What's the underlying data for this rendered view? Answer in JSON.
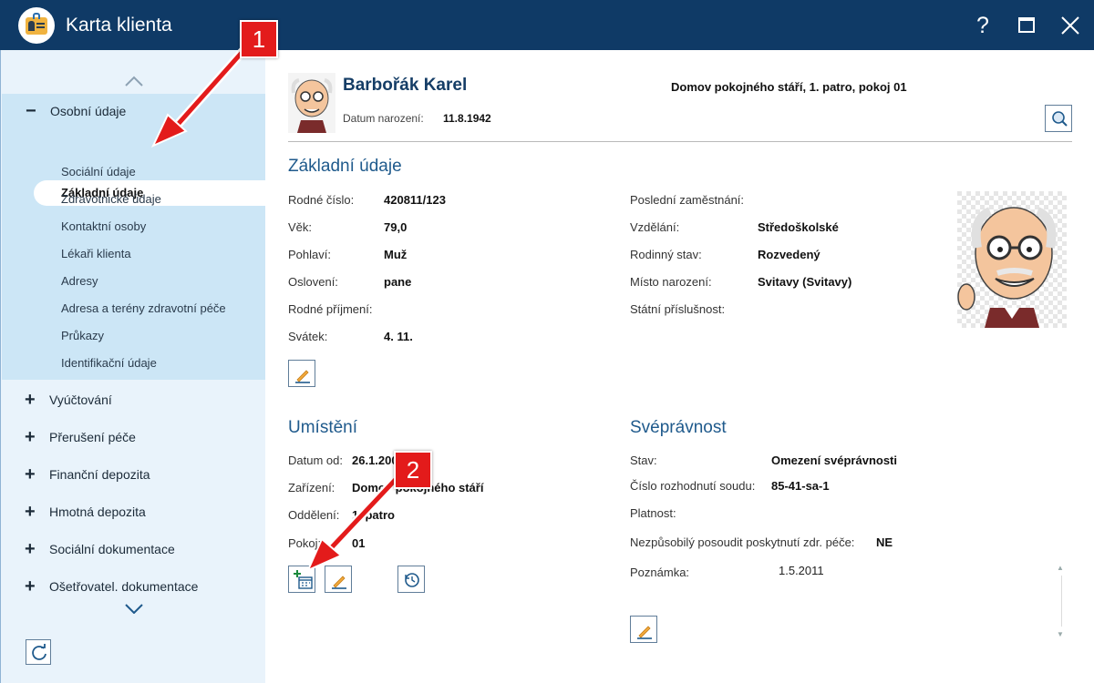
{
  "window": {
    "title": "Karta klienta",
    "help_label": "?"
  },
  "sidebar": {
    "expanded_group": "Osobní údaje",
    "sub_items": [
      "Základní údaje",
      "Sociální údaje",
      "Zdravotnické údaje",
      "Kontaktní osoby",
      "Lékaři klienta",
      "Adresy",
      "Adresa a terény zdravotní péče",
      "Průkazy",
      "Identifikační údaje"
    ],
    "active_sub_index": 0,
    "groups": [
      "Vyúčtování",
      "Přerušení péče",
      "Finanční depozita",
      "Hmotná depozita",
      "Sociální dokumentace",
      "Ošetřovatel. dokumentace"
    ]
  },
  "client": {
    "name": "Barbořák Karel",
    "location": "Domov pokojného stáří, 1. patro, pokoj 01",
    "dob_label": "Datum narození:",
    "dob_value": "11.8.1942"
  },
  "basic": {
    "title": "Základní údaje",
    "left": [
      {
        "label": "Rodné číslo:",
        "value": "420811/123"
      },
      {
        "label": "Věk:",
        "value": "79,0"
      },
      {
        "label": "Pohlaví:",
        "value": "Muž"
      },
      {
        "label": "Oslovení:",
        "value": "pane"
      },
      {
        "label": "Rodné příjmení:",
        "value": ""
      },
      {
        "label": "Svátek:",
        "value": "4. 11."
      }
    ],
    "right": [
      {
        "label": "Poslední zaměstnání:",
        "value": ""
      },
      {
        "label": "Vzdělání:",
        "value": "Středoškolské"
      },
      {
        "label": "Rodinný stav:",
        "value": "Rozvedený"
      },
      {
        "label": "Místo narození:",
        "value": "Svitavy (Svitavy)"
      },
      {
        "label": "Státní příslušnost:",
        "value": ""
      }
    ]
  },
  "placement": {
    "title": "Umístění",
    "rows": [
      {
        "label": "Datum od:",
        "value": "26.1.2003"
      },
      {
        "label": "Zařízení:",
        "value": "Domov pokojného stáří"
      },
      {
        "label": "Oddělení:",
        "value": "1. patro"
      },
      {
        "label": "Pokoj:",
        "value": "01"
      }
    ]
  },
  "capacity": {
    "title": "Svéprávnost",
    "rows": [
      {
        "label": "Stav:",
        "value": "Omezení svéprávnosti"
      },
      {
        "label": "Číslo rozhodnutí soudu:",
        "value": "85-41-sa-1"
      },
      {
        "label": "Platnost:",
        "value": ""
      },
      {
        "label": "Nezpůsobilý posoudit poskytnutí zdr. péče:",
        "value": "NE"
      },
      {
        "label": "Poznámka:",
        "value": "1.5.2011"
      }
    ]
  },
  "callouts": [
    "1",
    "2"
  ],
  "colors": {
    "titlebar": "#0f3a66",
    "sidebar": "#e9f3fb",
    "sidebar_expanded": "#cce6f6",
    "accent": "#1f5a8c",
    "callout": "#e31b1b"
  }
}
